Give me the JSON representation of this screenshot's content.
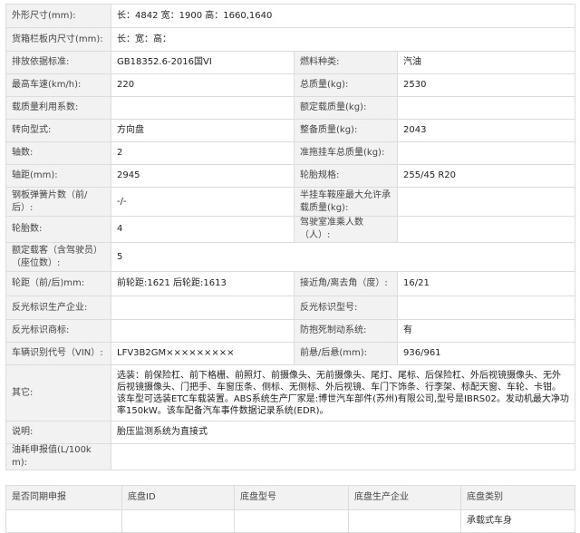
{
  "rows": [
    {
      "label": "外形尺寸(mm):",
      "value": "长：4842 宽：1900 高：1660,1640",
      "label2": null,
      "value2": null
    },
    {
      "label": "货箱栏板内尺寸(mm):",
      "value": "长：宽：高：",
      "label2": null,
      "value2": null
    },
    {
      "label": "排放依据标准:",
      "value": "GB18352.6-2016国VI",
      "label2": "燃料种类:",
      "value2": "汽油"
    },
    {
      "label": "最高车速(km/h):",
      "value": "220",
      "label2": "总质量(kg):",
      "value2": "2530"
    },
    {
      "label": "载质量利用系数:",
      "value": "",
      "label2": "额定载质量(kg):",
      "value2": ""
    },
    {
      "label": "转向型式:",
      "value": "方向盘",
      "label2": "整备质量(kg):",
      "value2": "2043"
    },
    {
      "label": "轴数:",
      "value": "2",
      "label2": "准拖挂车总质量(kg):",
      "value2": ""
    },
    {
      "label": "轴距(mm):",
      "value": "2945",
      "label2": "轮胎规格:",
      "value2": "255/45 R20"
    },
    {
      "label": "钢板弹簧片数（前/后）:",
      "value": "-/-",
      "label2": "半挂车鞍座最大允许承载质量(kg):",
      "value2": ""
    },
    {
      "label": "轮胎数:",
      "value": "4",
      "label2": "驾驶室准乘人数（人）:",
      "value2": ""
    },
    {
      "label": "额定载客（含驾驶员）（座位数）:",
      "value": "5",
      "label2": null,
      "value2": null
    },
    {
      "label": "轮距（前/后)mm:",
      "value": "前轮距:1621 后轮距:1613",
      "label2": "接近角/离去角（度）:",
      "value2": "16/21"
    },
    {
      "label": "反光标识生产企业:",
      "value": "",
      "label2": "反光标识型号:",
      "value2": ""
    },
    {
      "label": "反光标识商标:",
      "value": "",
      "label2": "防抱死制动系统:",
      "value2": "有"
    },
    {
      "label": "车辆识别代号（VIN）:",
      "value": "LFV3B2GM×××××××××",
      "label2": "前悬/后悬(mm):",
      "value2": "936/961"
    },
    {
      "label": "其它:",
      "value": "选装：前保险杠、前下格栅、前照灯、前摄像头、无前摄像头、尾灯、尾标、后保险杠、外后视镜摄像头、无外后视镜摄像头、门把手、车窗压条、侧标、无侧标、外后视镜、车门下饰条、行李架、标配天窗、车轮、卡钳。该车型可选装ETC车载装置。ABS系统生产厂家是:博世汽车部件(苏州)有限公司,型号是IBRS02。发动机最大净功率150kW。该车配备汽车事件数据记录系统(EDR)。",
      "label2": null,
      "value2": null
    },
    {
      "label": "说明:",
      "value": "胎压监测系统为直接式",
      "label2": null,
      "value2": null
    },
    {
      "label": "油耗申报值(L/100km):",
      "value": "",
      "label2": null,
      "value2": null
    }
  ],
  "chassis": {
    "headers": [
      "是否同期申报",
      "底盘ID",
      "底盘型号",
      "底盘生产企业",
      "底盘类别"
    ],
    "row": [
      "",
      "",
      "",
      "",
      "承载式车身"
    ]
  }
}
